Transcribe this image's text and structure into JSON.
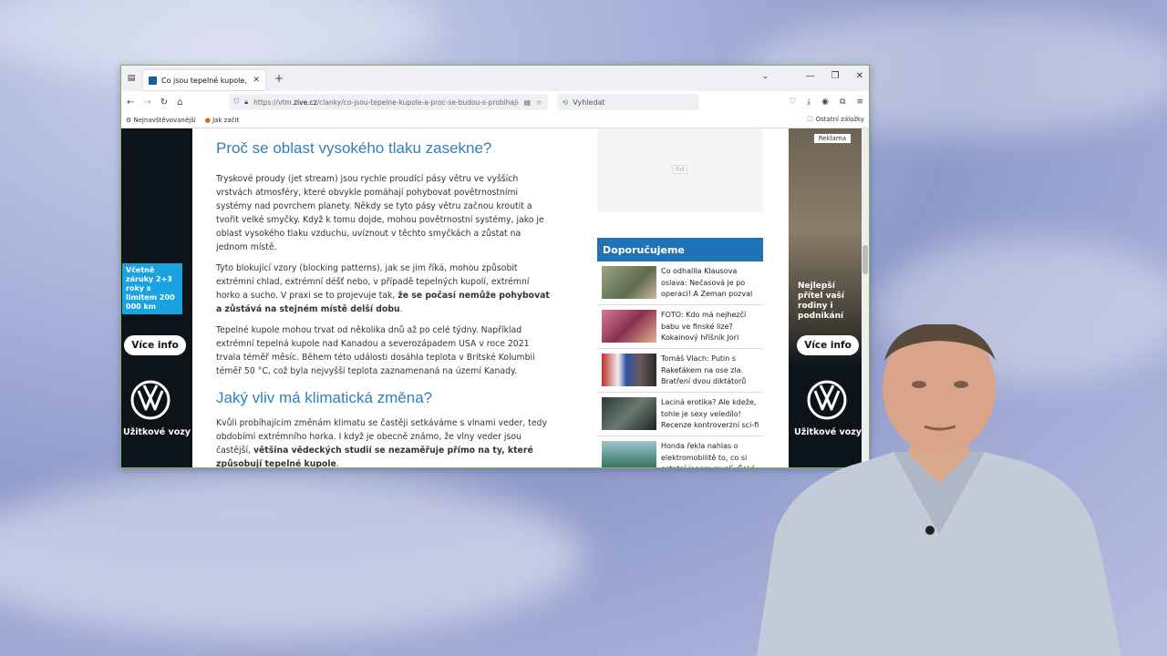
{
  "browser": {
    "tab_title": "Co jsou tepelné kupole, a proč se budou s probíhajícími klimatickými změnami častěji objevovat",
    "tab_title_short": "Co jsou tepelné kupole, a proč",
    "url_prefix": "https://vtm.",
    "url_domain": "zive.cz",
    "url_rest": "/clanky/co-jsou-tepelne-kupole-a-proc-se-budou-s-probihajic",
    "search_placeholder": "Vyhledat",
    "bookmarks": [
      {
        "label": "Nejnavštěvovanější"
      },
      {
        "label": "Jak začít"
      }
    ],
    "other_bookmarks": "Ostatní záložky"
  },
  "article": {
    "heading1": "Proč se oblast vysokého tlaku zasekne?",
    "p1": "Tryskové proudy (jet stream) jsou rychle proudící pásy větru ve vyšších vrstvách atmosféry, které obvykle pomáhají pohybovat povětrnostními systémy nad povrchem planety. Někdy se tyto pásy větru začnou kroutit a tvořit velké smyčky. Když k tomu dojde, mohou povětrnostní systémy, jako je oblast vysokého tlaku vzduchu, uvíznout v těchto smyčkách a zůstat na jednom místě.",
    "p2_a": "Tyto blokující vzory (blocking patterns), jak se jim říká, mohou způsobit extrémní chlad, extrémní déšť nebo, v případě tepelných kupolí, extrémní horko a sucho. V praxi se to projevuje tak, ",
    "p2_b": "že se počasí nemůže pohybovat a zůstává na stejném místě delší dobu",
    "p2_c": ".",
    "p3": "Tepelné kupole mohou trvat od několika dnů až po celé týdny. Například extrémní tepelná kupole nad Kanadou a severozápadem USA v roce 2021 trvala téměř měsíc. Během této události dosáhla teplota v Britské Kolumbii téměř 50 °C, což byla nejvyšší teplota zaznamenaná na území Kanady.",
    "heading2": "Jaký vliv má klimatická změna?",
    "p4_a": "Kvůli probíhajícím změnám klimatu se častěji setkáváme s vlnami veder, tedy obdobími extrémního horka. I když je obecně známo, že vlny veder jsou častější, ",
    "p4_b": "většina vědeckých studií se nezaměřuje přímo na ty, které způsobují tepelné kupole",
    "p4_c": "."
  },
  "ad_placeholder": "Rd",
  "recommend": {
    "title": "Doporučujeme",
    "items": [
      {
        "text": "Co odhalila Klausova oslava: Nečasová je po operaci! A Zeman pozval",
        "color": "#7d8a6a"
      },
      {
        "text": "FOTO: Kdo má nejhezčí babu ve finské lize? Kokainový hříšník Jori",
        "color": "#b0506a"
      },
      {
        "text": "Tomáš Vlach: Putin s Rakeťákem na ose zla. Bratření dvou diktátorů",
        "color": "#6a5a58"
      },
      {
        "text": "Laciná erotika? Ale kdeže, tohle je sexy veledílo! Recenze kontroverzní sci-fi",
        "color": "#3d4a44"
      },
      {
        "text": "Honda řekla nahlas o elektromobilitě to, co si ostatní jenom myslí. Čeká",
        "color": "#4a7a70"
      }
    ]
  },
  "ad_left": {
    "warranty": "Včetně záruky 2+3 roky s limitem 200 000 km",
    "button": "Více info",
    "brand": "Užitkové vozy"
  },
  "ad_right": {
    "badge": "Reklama",
    "tagline": "Nejlepší přítel vaší rodiny i podnikání",
    "button": "Více info",
    "brand": "Užitkové vozy"
  }
}
